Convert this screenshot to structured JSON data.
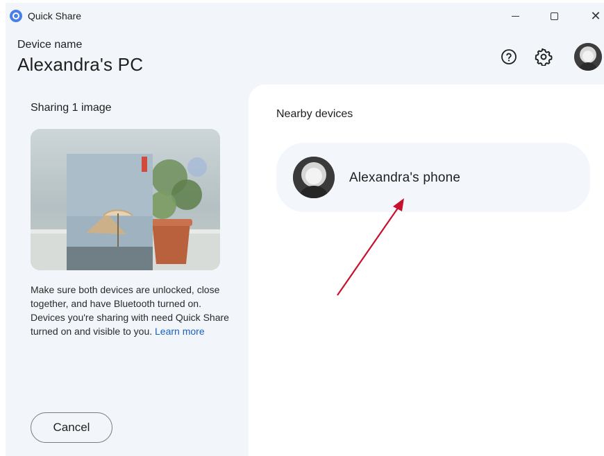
{
  "window": {
    "title": "Quick Share",
    "controls": {
      "minimize": "—",
      "maximize": "□",
      "close": "✕"
    }
  },
  "header": {
    "device_name_label": "Device name",
    "device_name_value": "Alexandra's PC",
    "icons": [
      "help-icon",
      "settings-gear-icon",
      "account-avatar"
    ]
  },
  "left_panel": {
    "sharing_title": "Sharing 1 image",
    "help_text": "Make sure both devices are unlocked, close together, and have Bluetooth turned on. Devices you're sharing with need Quick Share turned on and visible to you.",
    "learn_more_link": "Learn more",
    "cancel_label": "Cancel"
  },
  "right_panel": {
    "nearby_title": "Nearby devices",
    "devices": [
      {
        "name": "Alexandra's phone"
      }
    ]
  },
  "colors": {
    "window_bg": "#f2f5fa",
    "panel_bg": "#ffffff",
    "card_bg": "#f3f6fb",
    "link": "#1a5fc8",
    "annotation_arrow": "#c8102e"
  }
}
